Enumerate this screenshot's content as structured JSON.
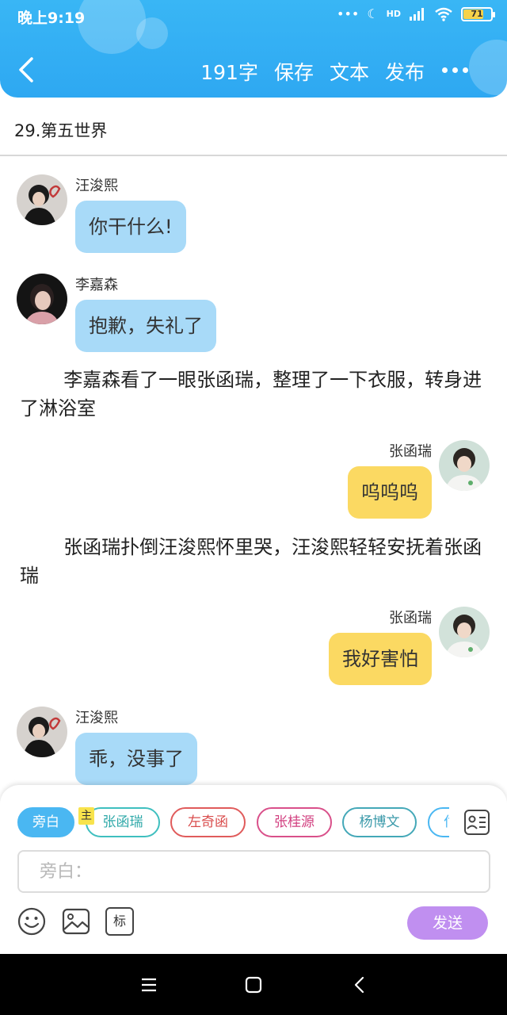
{
  "status": {
    "time": "晚上9:19",
    "battery": "71",
    "hd_label": "HD"
  },
  "header": {
    "word_count": "191字",
    "save": "保存",
    "text": "文本",
    "publish": "发布"
  },
  "chapter": {
    "title": "29.第五世界"
  },
  "messages": [
    {
      "name": "汪浚熙",
      "text": "你干什么!"
    },
    {
      "name": "李嘉森",
      "text": "抱歉，失礼了"
    },
    {
      "narration": "李嘉森看了一眼张函瑞，整理了一下衣服，转身进了淋浴室"
    },
    {
      "name": "张函瑞",
      "text": "呜呜呜"
    },
    {
      "narration": "张函瑞扑倒汪浚熙怀里哭，汪浚熙轻轻安抚着张函瑞"
    },
    {
      "name": "张函瑞",
      "text": "我好害怕"
    },
    {
      "name": "汪浚熙",
      "text": "乖，没事了"
    }
  ],
  "composer": {
    "chips": [
      "旁白",
      "张函瑞",
      "左奇函",
      "张桂源",
      "杨博文",
      "付"
    ],
    "main_badge": "主",
    "placeholder": "旁白：",
    "send": "发送",
    "tag_tool": "标"
  },
  "colors": {
    "accent": "#2ea8f2",
    "blue_bubble": "#a8daf8",
    "yellow_bubble": "#fbd962",
    "send": "#c08ff0"
  }
}
